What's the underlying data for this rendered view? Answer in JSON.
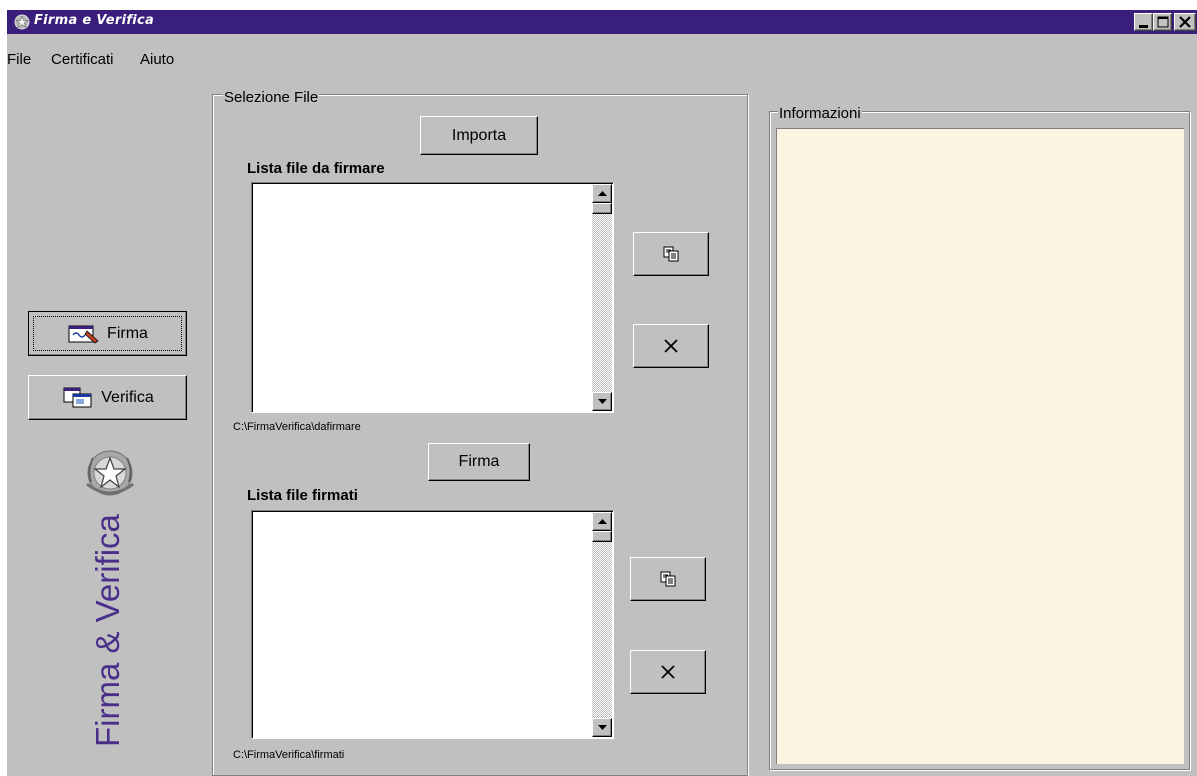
{
  "window": {
    "title": "Firma e Verifica"
  },
  "menu": [
    "File",
    "Certificati",
    "Aiuto"
  ],
  "sidebar": {
    "firma_label": "Firma",
    "verifica_label": "Verifica",
    "logo_text": "Firma & Verifica"
  },
  "selezione": {
    "title": "Selezione File",
    "import_label": "Importa",
    "to_sign_list_label": "Lista file da firmare",
    "to_sign_path": "C:\\FirmaVerifica\\dafirmare",
    "sign_label": "Firma",
    "signed_list_label": "Lista file firmati",
    "signed_path": "C:\\FirmaVerifica\\firmati"
  },
  "info": {
    "title": "Informazioni"
  },
  "colors": {
    "titlebar": "#3a1e7c",
    "logo_text": "#4a2f8a",
    "info_background": "#fbf4e3",
    "window_bg": "#c0c0c0"
  }
}
